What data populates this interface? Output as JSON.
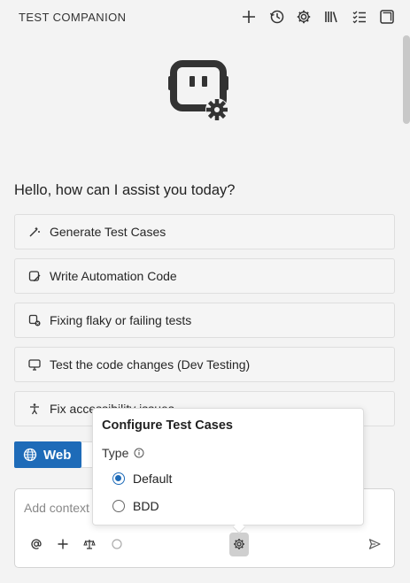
{
  "header": {
    "title": "TEST COMPANION",
    "icons": [
      "plus-icon",
      "history-icon",
      "gear-icon",
      "library-icon",
      "checklist-icon",
      "panel-icon"
    ]
  },
  "logo": {
    "icon": "robot-gear-icon"
  },
  "greeting": "Hello, how can I assist you today?",
  "suggestions": [
    {
      "label": "Generate Test Cases",
      "icon": "magic-wand-icon"
    },
    {
      "label": "Write Automation Code",
      "icon": "code-edit-icon"
    },
    {
      "label": "Fixing flaky or failing tests",
      "icon": "bug-fix-icon"
    },
    {
      "label": "Test the code changes (Dev Testing)",
      "icon": "screen-check-icon"
    },
    {
      "label": "Fix accessibility issues",
      "icon": "accessibility-icon"
    }
  ],
  "platform_toggle": {
    "web_label": "Web"
  },
  "chat": {
    "placeholder": "Add context",
    "toolbar_icons": [
      "at-icon",
      "plus-icon",
      "scale-icon",
      "circle-icon",
      "gear-icon",
      "send-icon"
    ]
  },
  "popover": {
    "title": "Configure Test Cases",
    "type_label": "Type",
    "options": [
      {
        "label": "Default",
        "selected": true
      },
      {
        "label": "BDD",
        "selected": false
      }
    ]
  },
  "colors": {
    "accent": "#1e6bb8",
    "background": "#f3f3f3"
  }
}
